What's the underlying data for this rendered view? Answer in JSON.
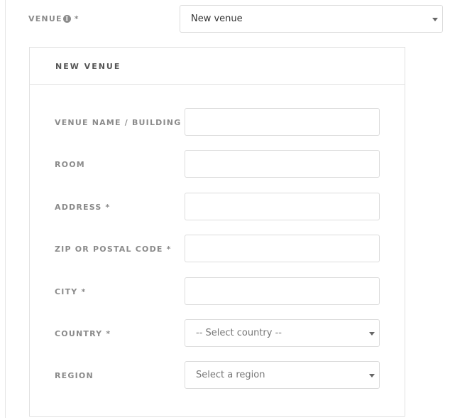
{
  "venue": {
    "label": "VENUE",
    "required_mark": "*",
    "selected": "New venue"
  },
  "icons": {
    "info": "info-icon",
    "caret": "chevron-down-icon"
  },
  "panel": {
    "title": "NEW VENUE",
    "fields": {
      "venue_name": {
        "label": "VENUE NAME / BUILDING *",
        "value": ""
      },
      "room": {
        "label": "ROOM",
        "value": ""
      },
      "address": {
        "label": "ADDRESS *",
        "value": ""
      },
      "zip": {
        "label": "ZIP OR POSTAL CODE *",
        "value": ""
      },
      "city": {
        "label": "CITY *",
        "value": ""
      },
      "country": {
        "label": "COUNTRY *",
        "selected": "-- Select country --"
      },
      "region": {
        "label": "REGION",
        "selected": "Select a region"
      }
    }
  }
}
